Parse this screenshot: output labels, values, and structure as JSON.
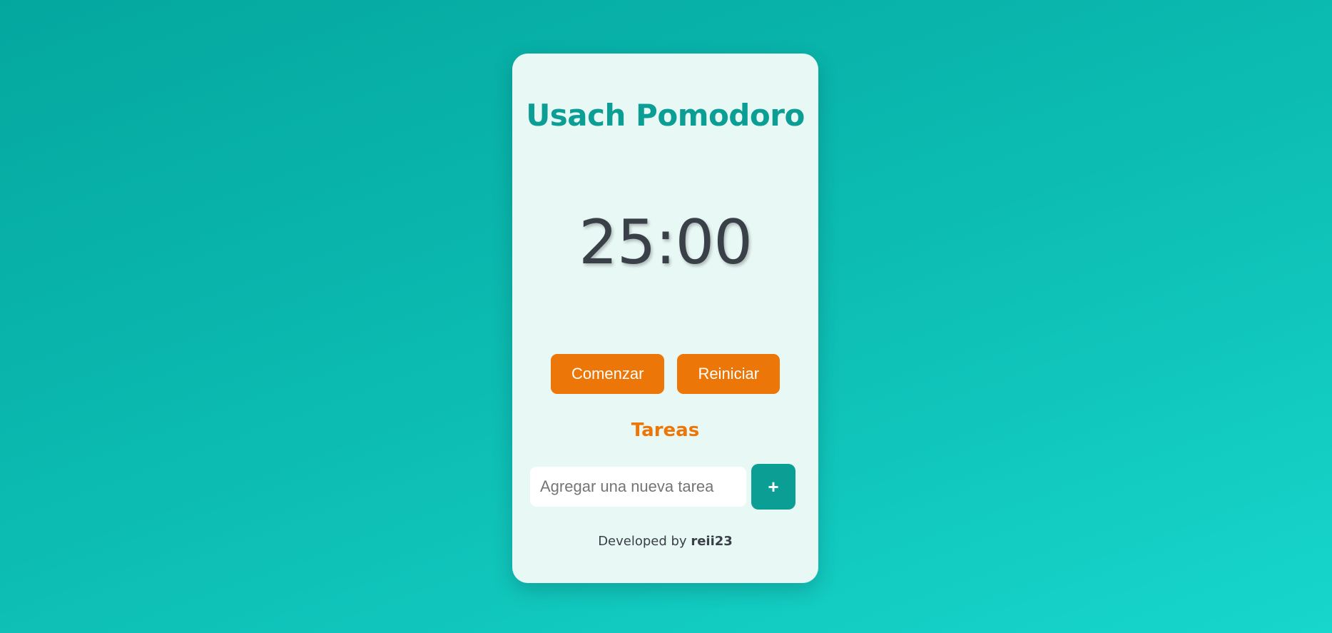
{
  "app": {
    "title": "Usach Pomodoro"
  },
  "timer": {
    "display": "25:00"
  },
  "controls": {
    "start_label": "Comenzar",
    "reset_label": "Reiniciar"
  },
  "tasks": {
    "heading": "Tareas",
    "input_value": "",
    "input_placeholder": "Agregar una nueva tarea",
    "add_label": "+",
    "add_icon": "plus-icon"
  },
  "footer": {
    "prefix": "Developed by ",
    "author": "reii23"
  },
  "colors": {
    "accent_teal": "#0b9e95",
    "accent_orange": "#ec7607",
    "card_background": "#e8f8f5",
    "timer_text": "#3a4048"
  }
}
